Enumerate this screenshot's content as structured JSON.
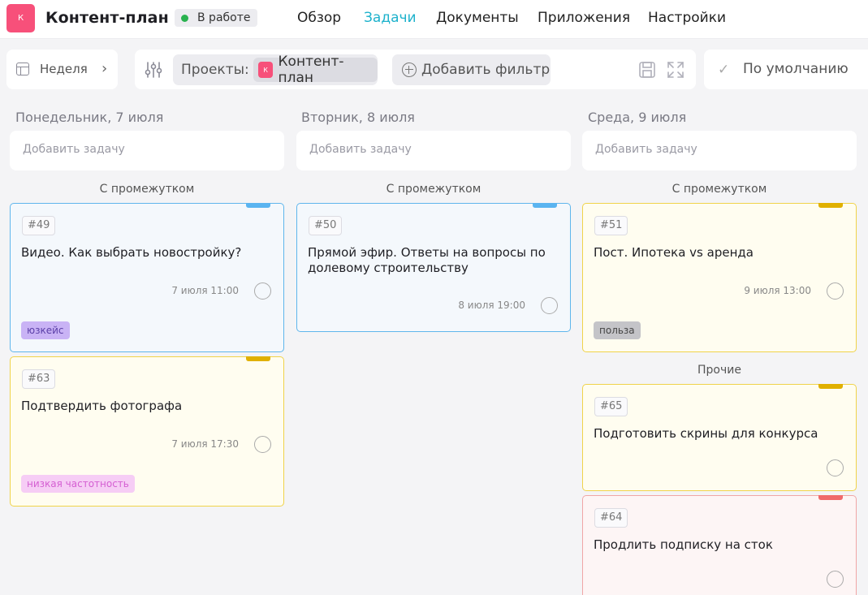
{
  "header": {
    "logo_text": "К",
    "title": "Контент-план",
    "status": "В работе",
    "nav": [
      "Обзор",
      "Задачи",
      "Документы",
      "Приложения",
      "Настройки"
    ]
  },
  "toolbar": {
    "week_label": "Неделя",
    "projects_label": "Проекты:",
    "project_logo": "К",
    "project_name": "Контент-план",
    "add_filter": "Добавить фильтр",
    "view_default": "По умолчанию"
  },
  "columns": [
    {
      "day": "Понедельник, 7 июля",
      "add_placeholder": "Добавить задачу",
      "section": "С промежутком",
      "cards": [
        {
          "num": "#49",
          "title": "Видео. Как выбрать новостройку?",
          "datetime": "7 июля 11:00",
          "tag": "юзкейс",
          "color": "blue"
        },
        {
          "num": "#63",
          "title": "Подтвердить фотографа",
          "datetime": "7 июля 17:30",
          "tag": "низкая частотность",
          "color": "yellow"
        }
      ]
    },
    {
      "day": "Вторник, 8 июля",
      "add_placeholder": "Добавить задачу",
      "section": "С промежутком",
      "cards": [
        {
          "num": "#50",
          "title": "Прямой эфир. Ответы на вопросы по долевому строительству",
          "datetime": "8 июля 19:00",
          "color": "blue"
        }
      ]
    },
    {
      "day": "Среда, 9 июля",
      "add_placeholder": "Добавить задачу",
      "section": "С промежутком",
      "section2": "Прочие",
      "cards": [
        {
          "num": "#51",
          "title": "Пост. Ипотека vs аренда",
          "datetime": "9 июля 13:00",
          "tag": "польза",
          "color": "yellow"
        },
        {
          "num": "#65",
          "title": "Подготовить скрины для конкурса",
          "color": "yellow"
        },
        {
          "num": "#64",
          "title": "Продлить подписку на сток",
          "color": "red"
        }
      ]
    }
  ],
  "colors": {
    "accent": "#1eb2cc",
    "logo": "#f7507a",
    "status_dot": "#29b24f",
    "tag_usecase": "#c9b3f5",
    "tag_lowfreq": "#f6cdf5",
    "tag_benefit": "#c4c4c8"
  }
}
